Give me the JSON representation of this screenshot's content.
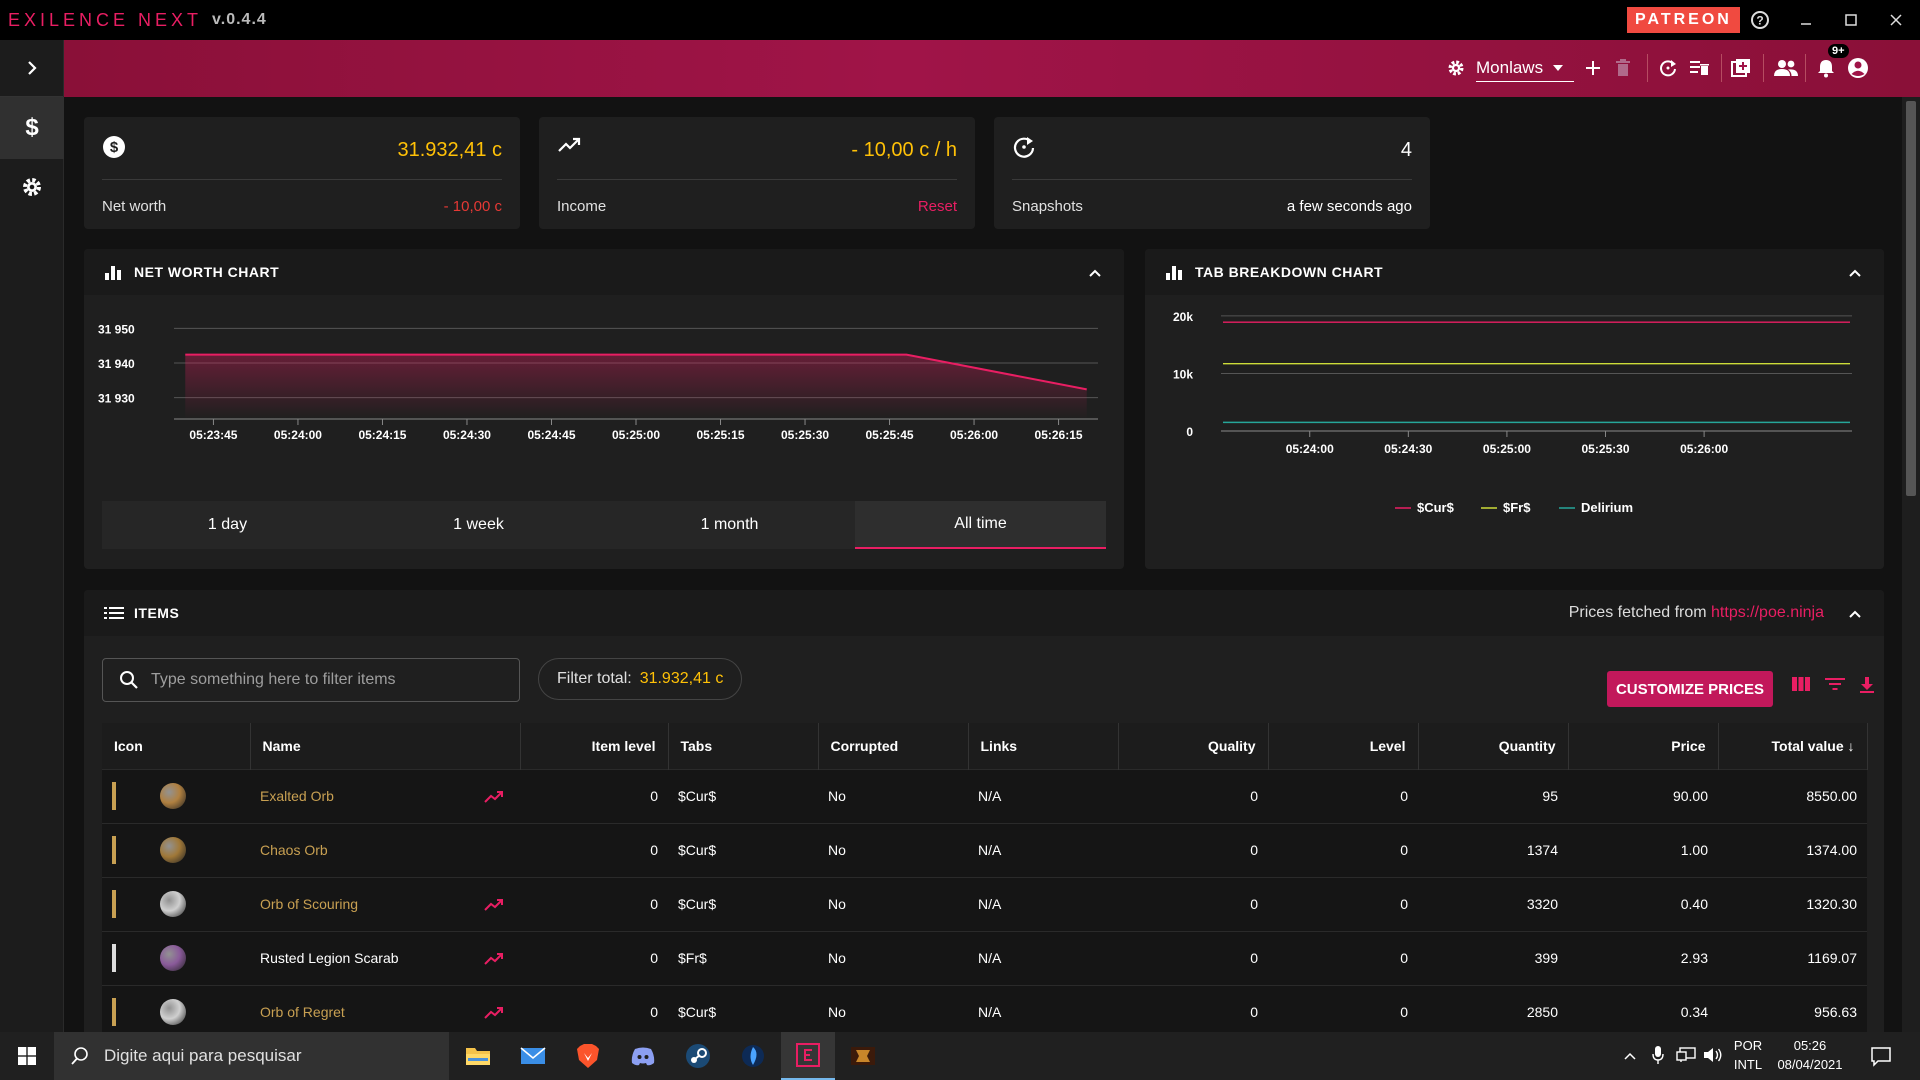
{
  "app": {
    "title": "EXILENCE NEXT",
    "version": "v.0.4.4",
    "patreon": "PATREON"
  },
  "appbar": {
    "profile": "Monlaws",
    "notification_badge": "9+"
  },
  "stats": {
    "net_worth": {
      "value": "31.932,41 c",
      "label": "Net worth",
      "change": "- 10,00 c"
    },
    "income": {
      "value": "- 10,00 c / h",
      "label": "Income",
      "reset": "Reset"
    },
    "snapshots": {
      "value": "4",
      "label": "Snapshots",
      "time": "a few seconds ago"
    }
  },
  "net_worth_panel": {
    "title": "NET WORTH CHART",
    "ranges": [
      "1 day",
      "1 week",
      "1 month",
      "All time"
    ],
    "active_range": "All time"
  },
  "tab_panel": {
    "title": "TAB BREAKDOWN CHART"
  },
  "chart_data": [
    {
      "type": "area",
      "title": "NET WORTH CHART",
      "y_ticks": [
        "31 950",
        "31 940",
        "31 930"
      ],
      "x_ticks": [
        "05:23:45",
        "05:24:00",
        "05:24:15",
        "05:24:30",
        "05:24:45",
        "05:25:00",
        "05:25:15",
        "05:25:30",
        "05:25:45",
        "05:26:00",
        "05:26:15"
      ],
      "ylim": [
        31925,
        31955
      ],
      "series": [
        {
          "x": [
            "05:23:40",
            "05:25:48",
            "05:26:20"
          ],
          "values": [
            31942.4,
            31942.4,
            31932.4
          ],
          "color": "#e91e63"
        }
      ]
    },
    {
      "type": "line",
      "title": "TAB BREAKDOWN CHART",
      "y_ticks": [
        "20k",
        "10k",
        "0"
      ],
      "x_ticks": [
        "05:24:00",
        "05:24:30",
        "05:25:00",
        "05:25:30",
        "05:26:00"
      ],
      "ylim": [
        0,
        20500
      ],
      "series": [
        {
          "name": "$Cur$",
          "color": "#e91e63",
          "values": [
            18900,
            18900,
            18900,
            18900,
            18900
          ]
        },
        {
          "name": "$Fr$",
          "color": "#cddc39",
          "values": [
            11700,
            11700,
            11700,
            11700,
            11700
          ]
        },
        {
          "name": "Delirium",
          "color": "#26a69a",
          "values": [
            1500,
            1500,
            1500,
            1500,
            1500
          ]
        }
      ]
    }
  ],
  "items_panel": {
    "title": "ITEMS",
    "prices_prefix": "Prices fetched from",
    "prices_link": "https://poe.ninja",
    "search_placeholder": "Type something here to filter items",
    "filter_total_label": "Filter total:",
    "filter_total_value": "31.932,41 c",
    "customize_button": "CUSTOMIZE PRICES",
    "columns": [
      "Icon",
      "Name",
      "Item level",
      "Tabs",
      "Corrupted",
      "Links",
      "Quality",
      "Level",
      "Quantity",
      "Price",
      "Total value"
    ],
    "rows": [
      {
        "name": "Exalted Orb",
        "trend": true,
        "ilvl": "0",
        "tab": "$Cur$",
        "corrupted": "No",
        "links": "N/A",
        "quality": "0",
        "level": "0",
        "quantity": "95",
        "price": "90.00",
        "total": "8550.00",
        "rarity": "#c8a052",
        "icon": "#b08040"
      },
      {
        "name": "Chaos Orb",
        "trend": false,
        "ilvl": "0",
        "tab": "$Cur$",
        "corrupted": "No",
        "links": "N/A",
        "quality": "0",
        "level": "0",
        "quantity": "1374",
        "price": "1.00",
        "total": "1374.00",
        "rarity": "#c8a052",
        "icon": "#a07838"
      },
      {
        "name": "Orb of Scouring",
        "trend": true,
        "ilvl": "0",
        "tab": "$Cur$",
        "corrupted": "No",
        "links": "N/A",
        "quality": "0",
        "level": "0",
        "quantity": "3320",
        "price": "0.40",
        "total": "1320.30",
        "rarity": "#c8a052",
        "icon": "#cfcfcf"
      },
      {
        "name": "Rusted Legion Scarab",
        "trend": true,
        "ilvl": "0",
        "tab": "$Fr$",
        "corrupted": "No",
        "links": "N/A",
        "quality": "0",
        "level": "0",
        "quantity": "399",
        "price": "2.93",
        "total": "1169.07",
        "rarity": "#dddddd",
        "icon": "#8a5a9a"
      },
      {
        "name": "Orb of Regret",
        "trend": true,
        "ilvl": "0",
        "tab": "$Cur$",
        "corrupted": "No",
        "links": "N/A",
        "quality": "0",
        "level": "0",
        "quantity": "2850",
        "price": "0.34",
        "total": "956.63",
        "rarity": "#c8a052",
        "icon": "#d0d0d0"
      }
    ]
  },
  "taskbar": {
    "search_placeholder": "Digite aqui para pesquisar",
    "lang_top": "POR",
    "lang_bottom": "INTL",
    "time": "05:26",
    "date": "08/04/2021"
  }
}
